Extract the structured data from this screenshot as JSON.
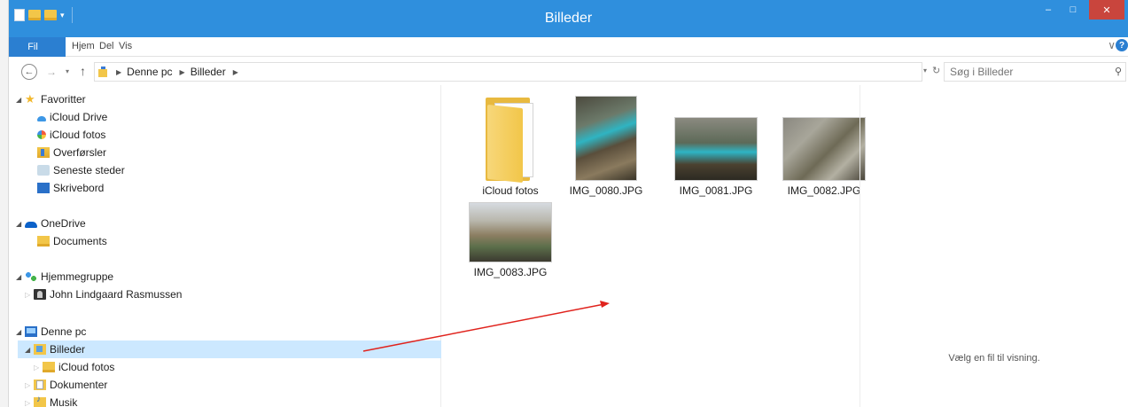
{
  "window": {
    "title": "Billeder",
    "minimize_glyph": "–",
    "maximize_glyph": "□",
    "close_glyph": "✕"
  },
  "ribbon": {
    "file_label": "Fil",
    "tabs": [
      "Hjem",
      "Del",
      "Vis"
    ],
    "expand_glyph": "∨",
    "help_glyph": "?"
  },
  "address": {
    "crumbs": [
      "Denne pc",
      "Billeder"
    ]
  },
  "search": {
    "placeholder": "Søg i Billeder"
  },
  "navigation": {
    "favorites": {
      "label": "Favoritter",
      "items": [
        "iCloud Drive",
        "iCloud fotos",
        "Overførsler",
        "Seneste steder",
        "Skrivebord"
      ]
    },
    "onedrive": {
      "label": "OneDrive",
      "items": [
        "Documents"
      ]
    },
    "homegroup": {
      "label": "Hjemmegruppe",
      "items": [
        "John Lindgaard Rasmussen"
      ]
    },
    "thispc": {
      "label": "Denne pc",
      "selected": "Billeder",
      "items": [
        "iCloud fotos",
        "Dokumenter",
        "Musik"
      ]
    }
  },
  "files": [
    {
      "name": "iCloud fotos",
      "type": "folder"
    },
    {
      "name": "IMG_0080.JPG",
      "type": "image"
    },
    {
      "name": "IMG_0081.JPG",
      "type": "image"
    },
    {
      "name": "IMG_0082.JPG",
      "type": "image"
    },
    {
      "name": "IMG_0083.JPG",
      "type": "image"
    }
  ],
  "preview": {
    "empty_text": "Vælg en fil til visning."
  },
  "colors": {
    "titlebar": "#2f8fdd",
    "file_tab": "#2b7fd1",
    "selection": "#cce8ff",
    "annotation_arrow": "#e0231d"
  }
}
